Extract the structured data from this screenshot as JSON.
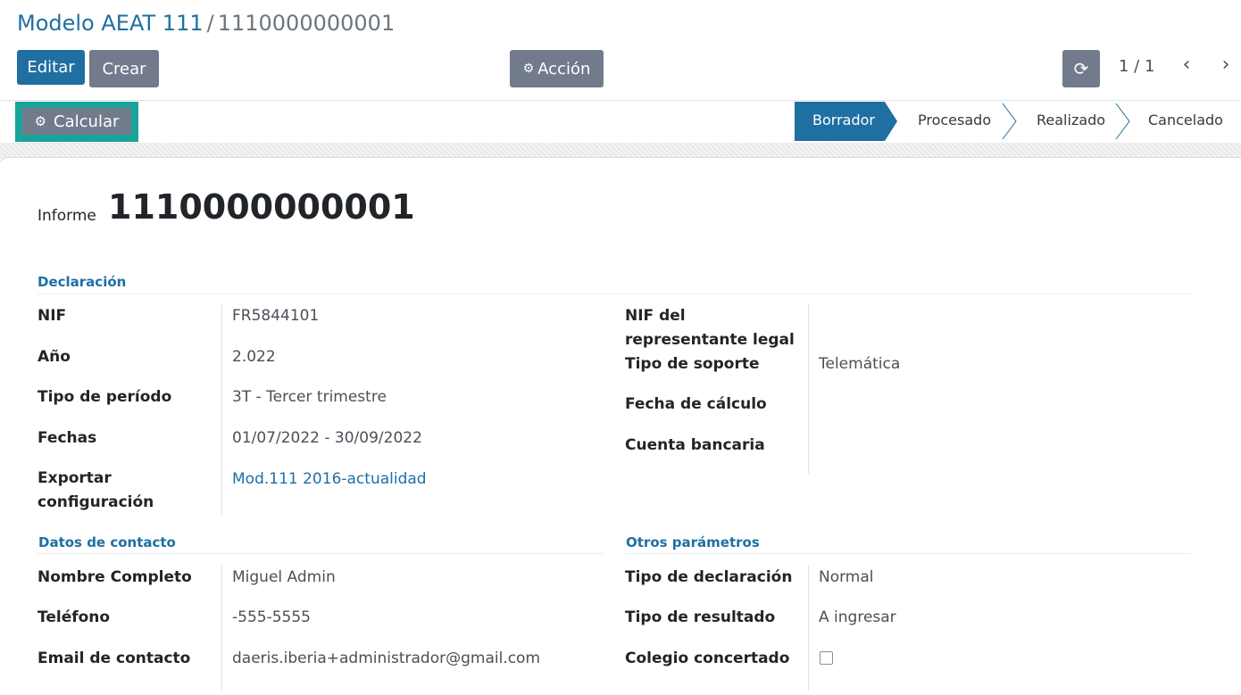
{
  "breadcrumb": {
    "parent": "Modelo AEAT 111",
    "separator": "/",
    "current": "1110000000001"
  },
  "toolbar": {
    "edit_label": "Editar",
    "create_label": "Crear",
    "action_label": "Acción"
  },
  "pager": {
    "value": "1 / 1"
  },
  "statusbar": {
    "calculate_label": "Calcular",
    "states": [
      "Borrador",
      "Procesado",
      "Realizado",
      "Cancelado"
    ],
    "active_state": "Borrador"
  },
  "form": {
    "title_label": "Informe",
    "title_value": "1110000000001",
    "declaracion": {
      "heading": "Declaración",
      "left": [
        {
          "label": "NIF",
          "value": "FR5844101"
        },
        {
          "label": "Año",
          "value": "2.022"
        },
        {
          "label": "Tipo de período",
          "value": "3T - Tercer trimestre"
        },
        {
          "label": "Fechas",
          "value": "01/07/2022 - 30/09/2022"
        },
        {
          "label_line1": "Exportar",
          "label_line2": "configuración",
          "value": "Mod.111 2016-actualidad"
        }
      ],
      "right": [
        {
          "label_line1": "NIF del",
          "label_line2": "representante legal",
          "value": ""
        },
        {
          "label": "Tipo de soporte",
          "value": "Telemática"
        },
        {
          "label": "Fecha de cálculo",
          "value": ""
        },
        {
          "label": "Cuenta bancaria",
          "value": ""
        }
      ]
    },
    "contacto": {
      "heading": "Datos de contacto",
      "rows": [
        {
          "label": "Nombre Completo",
          "value": "Miguel Admin"
        },
        {
          "label": "Teléfono",
          "value": "-555-5555"
        },
        {
          "label": "Email de contacto",
          "value": "daeris.iberia+administrador@gmail.com"
        }
      ]
    },
    "otros": {
      "heading": "Otros parámetros",
      "rows": [
        {
          "label": "Tipo de declaración",
          "value": "Normal"
        },
        {
          "label": "Tipo de resultado",
          "value": "A ingresar"
        },
        {
          "label": "Colegio concertado",
          "checked": false
        }
      ]
    }
  },
  "colors": {
    "primary": "#1f6fa3",
    "secondary": "#717b8c",
    "highlight": "#1aa39a"
  }
}
